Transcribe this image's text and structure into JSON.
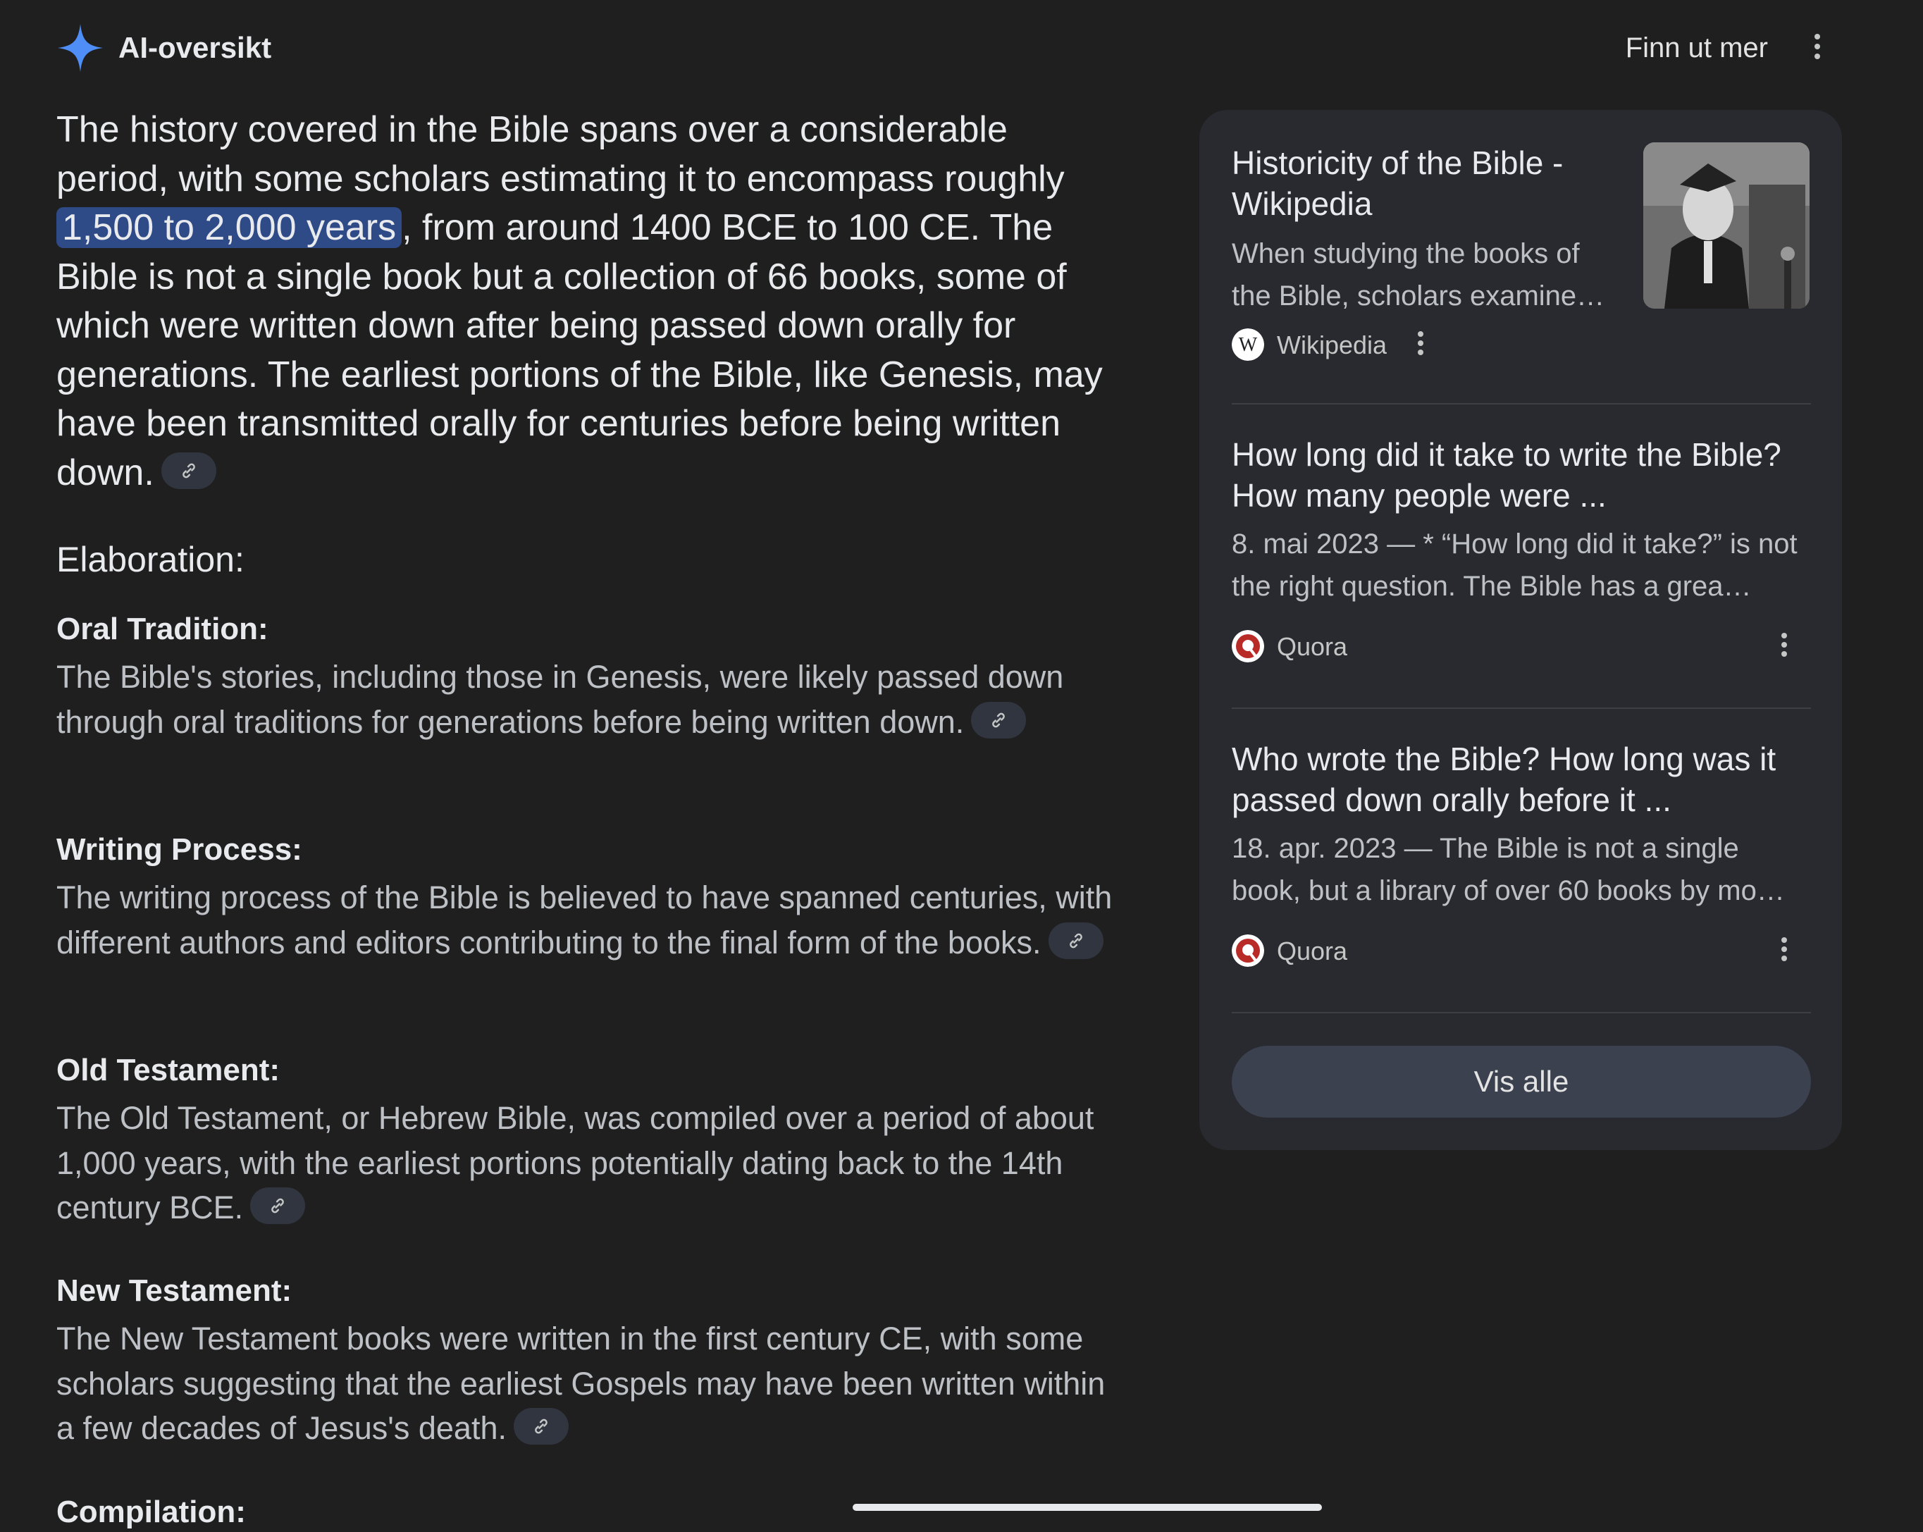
{
  "header": {
    "title": "AI-oversikt",
    "learn_more": "Finn ut mer"
  },
  "answer": {
    "lead_before": "The history covered in the Bible spans over a considerable period, with some scholars estimating it to encompass roughly ",
    "lead_highlight": "1,500 to 2,000 years",
    "lead_after": ", from around 1400 BCE to 100 CE. The Bible is not a single book but a collection of 66 books, some of which were written down after being passed down orally for generations. The earliest portions of the Bible, like Genesis, may have been transmitted orally for centuries before being written down.",
    "elaboration_heading": "Elaboration:",
    "sections": [
      {
        "heading": "Oral Tradition:",
        "text": "The Bible's stories, including those in Genesis, were likely passed down through oral traditions for generations before being written down."
      },
      {
        "heading": "Writing Process:",
        "text": "The writing process of the Bible is believed to have spanned centuries, with different authors and editors contributing to the final form of the books."
      },
      {
        "heading": "Old Testament:",
        "text": "The Old Testament, or Hebrew Bible, was compiled over a period of about 1,000 years, with the earliest portions potentially dating back to the 14th century BCE."
      },
      {
        "heading": "New Testament:",
        "text": "The New Testament books were written in the first century CE, with some scholars suggesting that the earliest Gospels may have been written within a few decades of Jesus's death."
      },
      {
        "heading": "Compilation:",
        "text": ""
      }
    ]
  },
  "sources": {
    "cards": [
      {
        "title": "Historicity of the Bible - Wikipedia",
        "snippet": "When studying the books of the Bible, scholars examine…",
        "source": "Wikipedia"
      },
      {
        "title": "How long did it take to write the Bible? How many people were ...",
        "snippet": "8. mai 2023 — * “How long did it take?” is not the right question. The Bible has a grea…",
        "source": "Quora"
      },
      {
        "title": "Who wrote the Bible? How long was it passed down orally before it ...",
        "snippet": "18. apr. 2023 — The Bible is not a single book, but a library of over 60 books by mo…",
        "source": "Quora"
      }
    ],
    "show_all": "Vis alle"
  },
  "colors": {
    "background": "#1f1f1f",
    "panel": "#282a2f",
    "highlight": "#2e4a87",
    "sparkle": "#4f8ef7",
    "quora": "#b92b27"
  }
}
